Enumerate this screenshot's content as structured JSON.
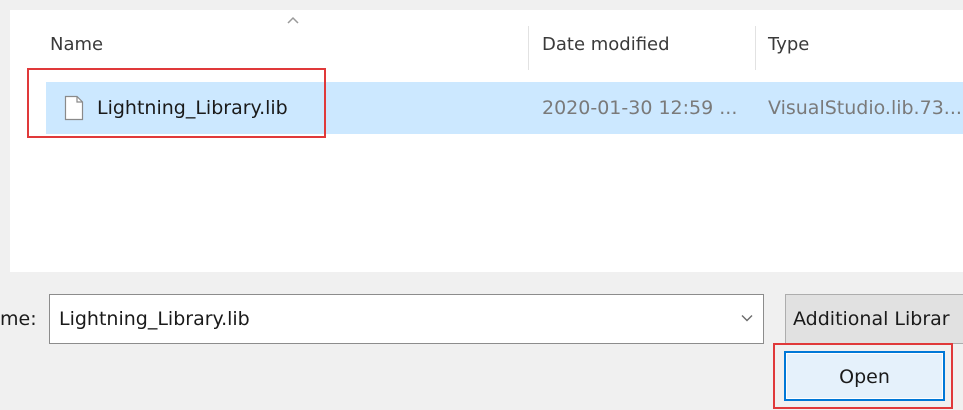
{
  "file_list": {
    "columns": {
      "name": "Name",
      "date_modified": "Date modified",
      "type": "Type"
    },
    "sort": {
      "column": "Name",
      "indicator": "sort-ascending-caret-icon"
    },
    "rows": [
      {
        "icon": "file-icon",
        "name": "Lightning_Library.lib",
        "date_modified": "2020-01-30 12:59 ...",
        "type": "VisualStudio.lib.73...",
        "selected": true,
        "highlighted": true
      }
    ]
  },
  "footer": {
    "file_name_label": "me:",
    "file_name_value": "Lightning_Library.lib",
    "file_name_dropdown_icon": "chevron-down-icon",
    "file_type_filter": "Additional Librar",
    "open_button_label": "Open",
    "open_button_highlighted": true
  },
  "colors": {
    "selection": "#cce8ff",
    "annotation_red": "#e0393a",
    "default_button_border": "#0078d7",
    "window_background": "#f0f0f0"
  }
}
